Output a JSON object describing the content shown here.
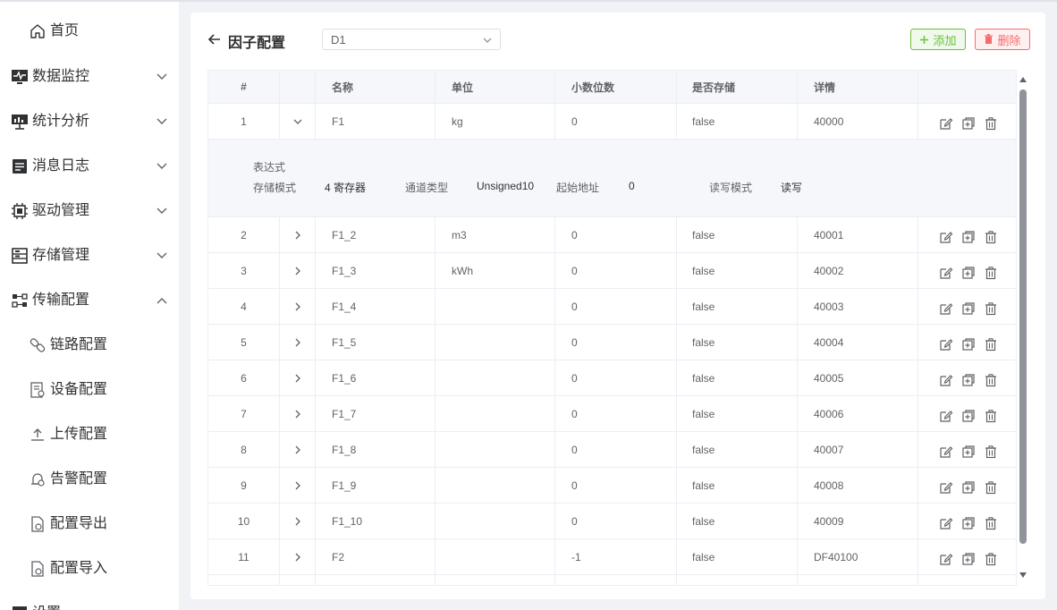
{
  "sidebar": {
    "items": [
      {
        "label": "首页",
        "icon": "home-icon"
      },
      {
        "label": "数据监控",
        "icon": "monitor-icon"
      },
      {
        "label": "统计分析",
        "icon": "presentation-icon"
      },
      {
        "label": "消息日志",
        "icon": "log-icon"
      },
      {
        "label": "驱动管理",
        "icon": "chip-icon"
      },
      {
        "label": "存储管理",
        "icon": "storage-icon"
      },
      {
        "label": "传输配置",
        "icon": "transfer-icon"
      },
      {
        "label": "链路配置",
        "icon": "link-icon"
      },
      {
        "label": "设备配置",
        "icon": "device-icon"
      },
      {
        "label": "上传配置",
        "icon": "upload-icon"
      },
      {
        "label": "告警配置",
        "icon": "alarm-icon"
      },
      {
        "label": "配置导出",
        "icon": "export-icon"
      },
      {
        "label": "配置导入",
        "icon": "import-icon"
      },
      {
        "label": "设置",
        "icon": "settings-icon"
      }
    ]
  },
  "header": {
    "title": "因子配置",
    "device_select": "D1",
    "add_label": "添加",
    "delete_label": "删除"
  },
  "table": {
    "columns": [
      "#",
      "名称",
      "单位",
      "小数位数",
      "是否存储",
      "详情"
    ],
    "rows": [
      {
        "idx": "1",
        "name": "F1",
        "unit": "kg",
        "decimals": "0",
        "store": "false",
        "detail": "40000",
        "expanded": true
      },
      {
        "idx": "2",
        "name": "F1_2",
        "unit": "m3",
        "decimals": "0",
        "store": "false",
        "detail": "40001"
      },
      {
        "idx": "3",
        "name": "F1_3",
        "unit": "kWh",
        "decimals": "0",
        "store": "false",
        "detail": "40002"
      },
      {
        "idx": "4",
        "name": "F1_4",
        "unit": "",
        "decimals": "0",
        "store": "false",
        "detail": "40003"
      },
      {
        "idx": "5",
        "name": "F1_5",
        "unit": "",
        "decimals": "0",
        "store": "false",
        "detail": "40004"
      },
      {
        "idx": "6",
        "name": "F1_6",
        "unit": "",
        "decimals": "0",
        "store": "false",
        "detail": "40005"
      },
      {
        "idx": "7",
        "name": "F1_7",
        "unit": "",
        "decimals": "0",
        "store": "false",
        "detail": "40006"
      },
      {
        "idx": "8",
        "name": "F1_8",
        "unit": "",
        "decimals": "0",
        "store": "false",
        "detail": "40007"
      },
      {
        "idx": "9",
        "name": "F1_9",
        "unit": "",
        "decimals": "0",
        "store": "false",
        "detail": "40008"
      },
      {
        "idx": "10",
        "name": "F1_10",
        "unit": "",
        "decimals": "0",
        "store": "false",
        "detail": "40009"
      },
      {
        "idx": "11",
        "name": "F2",
        "unit": "",
        "decimals": "-1",
        "store": "false",
        "detail": "DF40100"
      }
    ],
    "expand": {
      "expression_label": "表达式",
      "storage_mode_label": "存储模式",
      "storage_mode_value": "4 寄存器",
      "channel_type_label": "通道类型",
      "channel_type_value": "Unsigned10",
      "start_addr_label": "起始地址",
      "start_addr_value": "0",
      "rw_mode_label": "读写模式",
      "rw_mode_value": "读写"
    }
  },
  "colors": {
    "add": "#67c23a",
    "delete": "#f56c6c",
    "scrollbar": "#909399"
  }
}
